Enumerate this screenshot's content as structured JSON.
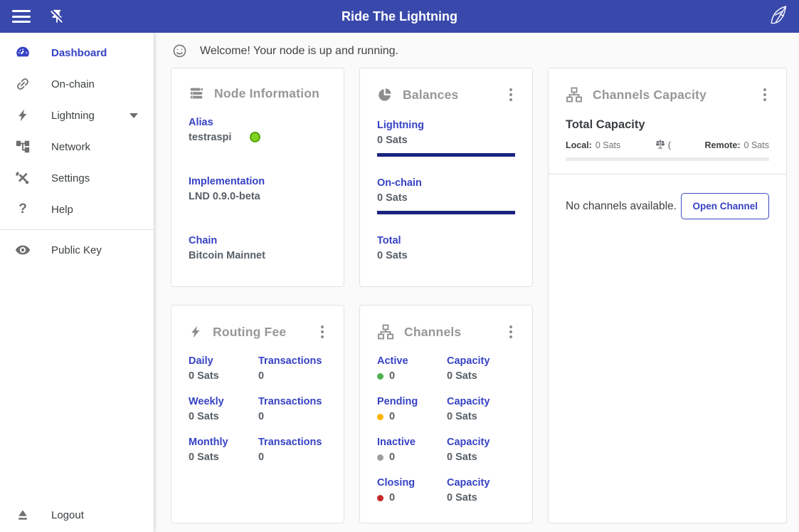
{
  "header": {
    "title": "Ride The Lightning"
  },
  "sidebar": {
    "items": [
      {
        "label": "Dashboard"
      },
      {
        "label": "On-chain"
      },
      {
        "label": "Lightning"
      },
      {
        "label": "Network"
      },
      {
        "label": "Settings"
      },
      {
        "label": "Help"
      },
      {
        "label": "Public Key"
      }
    ],
    "logout_label": "Logout"
  },
  "welcome": {
    "message": "Welcome! Your node is up and running."
  },
  "cards": {
    "node_info": {
      "title": "Node Information",
      "alias_label": "Alias",
      "alias_value": "testraspi",
      "impl_label": "Implementation",
      "impl_value": "LND 0.9.0-beta",
      "chain_label": "Chain",
      "chain_value": "Bitcoin Mainnet"
    },
    "balances": {
      "title": "Balances",
      "rows": [
        {
          "label": "Lightning",
          "value": "0 Sats"
        },
        {
          "label": "On-chain",
          "value": "0 Sats"
        },
        {
          "label": "Total",
          "value": "0 Sats"
        }
      ]
    },
    "channels_capacity": {
      "title": "Channels Capacity",
      "subtitle": "Total Capacity",
      "local_label": "Local:",
      "local_value": "0 Sats",
      "balance_paren": "(",
      "remote_label": "Remote:",
      "remote_value": "0 Sats",
      "empty_message": "No channels available.",
      "open_button_label": "Open Channel"
    },
    "routing_fee": {
      "title": "Routing Fee",
      "rows": [
        {
          "period": "Daily",
          "fee": "0 Sats",
          "tx_label": "Transactions",
          "tx_value": "0"
        },
        {
          "period": "Weekly",
          "fee": "0 Sats",
          "tx_label": "Transactions",
          "tx_value": "0"
        },
        {
          "period": "Monthly",
          "fee": "0 Sats",
          "tx_label": "Transactions",
          "tx_value": "0"
        }
      ]
    },
    "channels": {
      "title": "Channels",
      "rows": [
        {
          "label": "Active",
          "count": "0",
          "cap_label": "Capacity",
          "cap_value": "0 Sats"
        },
        {
          "label": "Pending",
          "count": "0",
          "cap_label": "Capacity",
          "cap_value": "0 Sats"
        },
        {
          "label": "Inactive",
          "count": "0",
          "cap_label": "Capacity",
          "cap_value": "0 Sats"
        },
        {
          "label": "Closing",
          "count": "0",
          "cap_label": "Capacity",
          "cap_value": "0 Sats"
        }
      ]
    }
  },
  "colors": {
    "header_bg": "#3949ab",
    "accent": "#3642c4",
    "balance_bar": "#1a237e",
    "active_dot": "#4caf50",
    "pending_dot": "#ffb300",
    "inactive_dot": "#9e9e9e",
    "closing_dot": "#c62828",
    "alias_status_dot": "#7ed321"
  }
}
